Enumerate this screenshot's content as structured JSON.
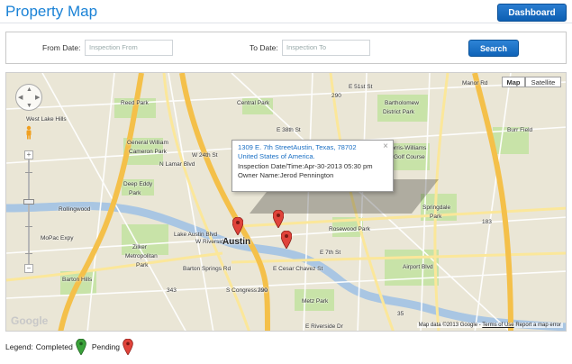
{
  "header": {
    "title": "Property Map",
    "dashboard_label": "Dashboard"
  },
  "filter": {
    "from_label": "From Date:",
    "from_placeholder": "Inspection From",
    "to_label": "To Date:",
    "to_placeholder": "Inspection To",
    "search_label": "Search"
  },
  "map": {
    "type_map": "Map",
    "type_satellite": "Satellite",
    "popup": {
      "address1": "1309 E. 7th StreetAustin, Texas, 78702",
      "address2": "United States of America.",
      "inspection": "Inspection Date/Time:Apr-30-2013 05:30 pm",
      "owner": "Owner Name:Jerod Pennington"
    },
    "labels": {
      "austin": "Austin",
      "reed_park": "Reed Park",
      "central_park": "Central Park",
      "bartholomew": "Bartholomew",
      "district_park": "District Park",
      "manor_rd": "Manor Rd",
      "west_lake_hills": "West Lake Hills",
      "general_william": "General William",
      "cameron_park": "Cameron Park",
      "morris_williams": "Morris-Williams",
      "golf_course": "Golf Course",
      "burr_field": "Burr Field",
      "rollingwood": "Rollingwood",
      "deep_eddy": "Deep Eddy",
      "park": "Park",
      "rosewood_park": "Rosewood Park",
      "springdale_park": "Springdale",
      "springdale_park2": "Park",
      "zilker": "Zilker",
      "metropolitan": "Metropolitan",
      "park3": "Park",
      "barton_hills": "Barton Hills",
      "metz_park": "Metz Park",
      "e_cesar_chavez": "E Cesar Chavez St",
      "e_7th": "E 7th St",
      "w_24th": "W 24th St",
      "e_51st": "E 51st St",
      "e_38th": "E 38th St",
      "mopac": "MoPac Expy",
      "airport_blvd": "Airport Blvd",
      "lamar": "N Lamar Blvd",
      "lake_austin": "Lake Austin Blvd",
      "barton_springs": "Barton Springs Rd",
      "w_riverside": "W Riverside Dr",
      "congress": "S Congress Ave",
      "e_riverside": "E Riverside Dr",
      "shield_290": "290",
      "shield_343": "343",
      "shield_183": "183",
      "shield_35": "35",
      "google": "Google"
    },
    "attribution": "Map data ©2013 Google -",
    "terms": "Terms of Use",
    "report": "Report a map error"
  },
  "legend": {
    "label": "Legend:",
    "completed": "Completed",
    "pending": "Pending"
  },
  "colors": {
    "accent": "#1a82d6",
    "pin_pending": "#e0433a",
    "pin_completed": "#3aa23a",
    "highway": "#f4c04a",
    "water": "#a9c6e3",
    "park": "#c6e3a9"
  }
}
